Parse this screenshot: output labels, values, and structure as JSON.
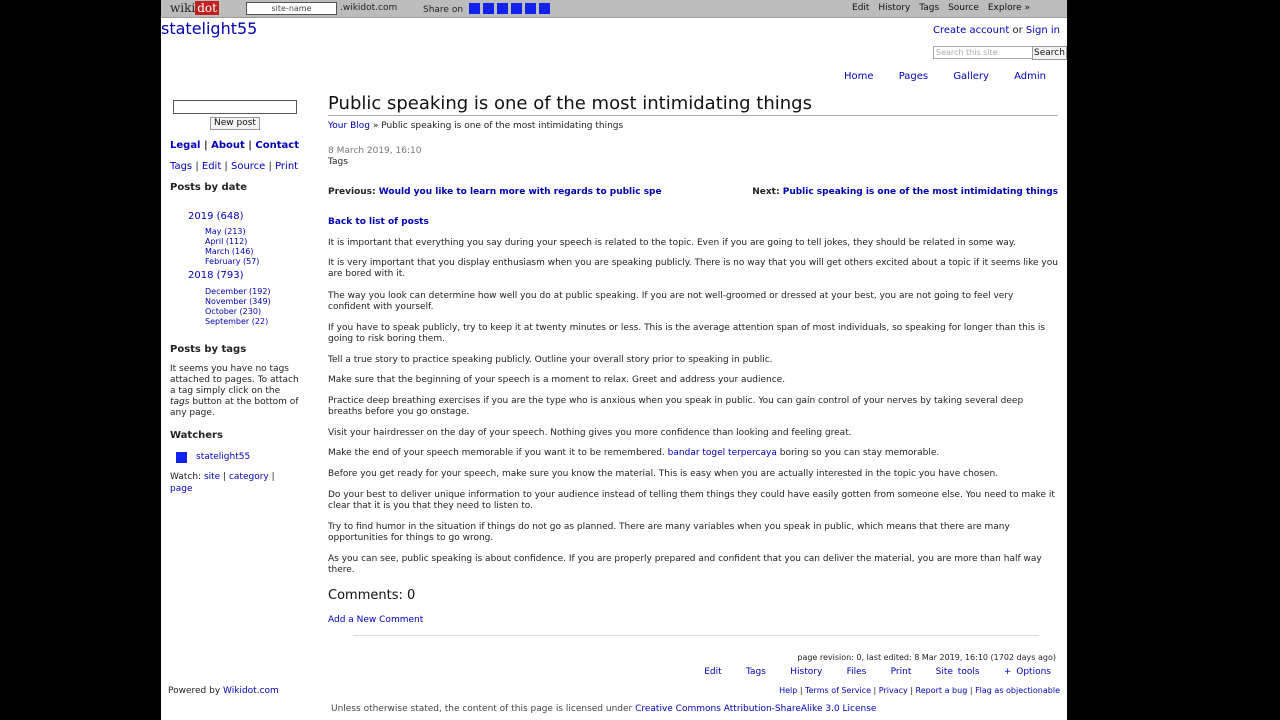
{
  "topbar": {
    "logo_left": "wiki",
    "logo_right": "dot",
    "sitename_placeholder": "site-name",
    "suffix": ".wikidot.com",
    "share_label": "Share on",
    "menu": [
      "Edit",
      "History",
      "Tags",
      "Source",
      "Explore »"
    ]
  },
  "site": {
    "title": "statelight55",
    "create_account": "Create account",
    "or": "or",
    "sign_in": "Sign in",
    "search_placeholder": "Search this site",
    "search_button": "Search"
  },
  "nav": [
    "Home",
    "Pages",
    "Gallery",
    "Admin"
  ],
  "sidebar": {
    "new_post": "New post",
    "legal": "Legal",
    "about": "About",
    "contact": "Contact",
    "tools": [
      "Tags",
      "Edit",
      "Source",
      "Print"
    ],
    "posts_by_date_heading": "Posts by date",
    "years": [
      {
        "label": "2019 (648)",
        "months": [
          "May (213)",
          "April (112)",
          "March (146)",
          "February (57)"
        ]
      },
      {
        "label": "2018 (793)",
        "months": [
          "December (192)",
          "November (349)",
          "October (230)",
          "September (22)"
        ]
      }
    ],
    "posts_by_tags_heading": "Posts by tags",
    "tags_text_1": "It seems you have no tags attached to pages. To attach a tag simply click on the ",
    "tags_text_em": "tags",
    "tags_text_2": " button at the bottom of any page.",
    "watchers_heading": "Watchers",
    "watcher_name": "statelight55",
    "watch_label": "Watch:",
    "watch_site": "site",
    "watch_category": "category",
    "watch_page": "page",
    "powered_by": "Powered by",
    "powered_link": "Wikidot.com"
  },
  "main": {
    "title": "Public speaking is one of the most intimidating things",
    "breadcrumb_link": "Your Blog",
    "breadcrumb_sep": " » ",
    "breadcrumb_current": "Public speaking is one of the most intimidating things",
    "date": "8 March 2019, 16:10",
    "tags": "Tags",
    "previous_label": "Previous:",
    "previous_link": "Would you like to learn more with regards to public spe",
    "next_label": "Next:",
    "next_link": "Public speaking is one of the most intimidating things",
    "back_link": "Back to list of posts",
    "paragraphs": [
      "It is important that everything you say during your speech is related to the topic. Even if you are going to tell jokes, they should be related in some way.",
      "It is very important that you display enthusiasm when you are speaking publicly. There is no way that you will get others excited about a topic if it seems like you are bored with it.",
      "The way you look can determine how well you do at public speaking. If you are not well-groomed or dressed at your best, you are not going to feel very confident with yourself.",
      "If you have to speak publicly, try to keep it at twenty minutes or less. This is the average attention span of most individuals, so speaking for longer than this is going to risk boring them.",
      "Tell a true story to practice speaking publicly. Outline your overall story prior to speaking in public.",
      "Make sure that the beginning of your speech is a moment to relax. Greet and address your audience.",
      "Practice deep breathing exercises if you are the type who is anxious when you speak in public. You can gain control of your nerves by taking several deep breaths before you go onstage.",
      "Visit your hairdresser on the day of your speech. Nothing gives you more confidence than looking and feeling great."
    ],
    "para9_a": "Make the end of your speech memorable if you want it to be remembered. ",
    "para9_link": "bandar togel terpercaya",
    "para9_b": " boring so you can stay memorable.",
    "paragraphs_after": [
      "Before you get ready for your speech, make sure you know the material. This is easy when you are actually interested in the topic you have chosen.",
      "Do your best to deliver unique information to your audience instead of telling them things they could have easily gotten from someone else. You need to make it clear that it is you that they need to listen to.",
      "Try to find humor in the situation if things do not go as planned. There are many variables when you speak in public, which means that there are many opportunities for things to go wrong.",
      "As you can see, public speaking is about confidence. If you are properly prepared and confident that you can deliver the material, you are more than half way there."
    ],
    "comments_heading": "Comments: 0",
    "add_comment": "Add a New Comment"
  },
  "footer": {
    "revision": "page revision: 0, last edited: 8 Mar 2019, 16:10 (1702 days ago)",
    "actions": [
      "Edit",
      "Tags",
      "History",
      "Files",
      "Print",
      "Site tools",
      "+ Options"
    ],
    "links": [
      "Help",
      "Terms of Service",
      "Privacy",
      "Report a bug",
      "Flag as objectionable"
    ],
    "license_text": "Unless otherwise stated, the content of this page is licensed under ",
    "license_link": "Creative Commons Attribution-ShareAlike 3.0 License"
  },
  "colors": {
    "link": "#0000b3",
    "topbar": "#bcbcbc",
    "share_squares": "#1122ee",
    "watcher_square": "#1122ee"
  }
}
